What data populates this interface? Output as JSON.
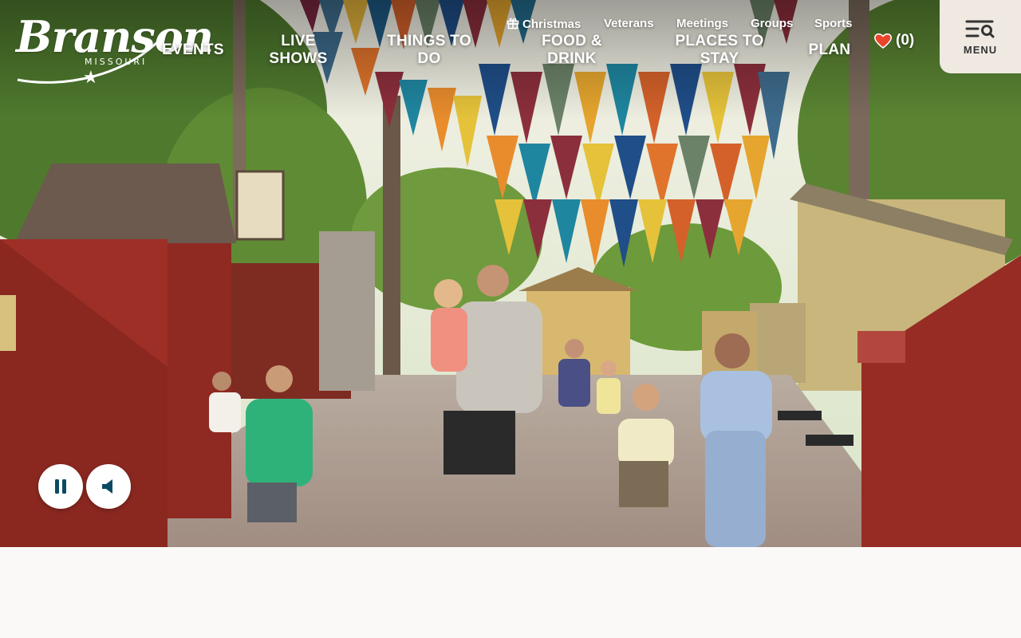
{
  "brand": {
    "logo_script": "Branson",
    "logo_sub": "MISSOURI",
    "logo_star": "★",
    "colors": {
      "accent_heart": "#e8452c",
      "menu_bg": "#efe9e2",
      "control_icon": "#0c4a63"
    }
  },
  "utility_nav": {
    "christmas": "Christmas",
    "christmas_icon": "gift-icon",
    "veterans": "Veterans",
    "meetings": "Meetings",
    "groups": "Groups",
    "sports": "Sports"
  },
  "main_nav": {
    "events": "EVENTS",
    "live_shows": "LIVE SHOWS",
    "things_to_do": "THINGS TO DO",
    "food_drink": "FOOD & DRINK",
    "places_to_stay": "PLACES TO STAY",
    "plan": "PLAN"
  },
  "favorites": {
    "count_label": "(0)",
    "icon": "heart-icon"
  },
  "menu": {
    "label": "MENU",
    "icon": "menu-search-icon"
  },
  "video_controls": {
    "pause_icon": "pause-icon",
    "mute_icon": "volume-icon"
  }
}
